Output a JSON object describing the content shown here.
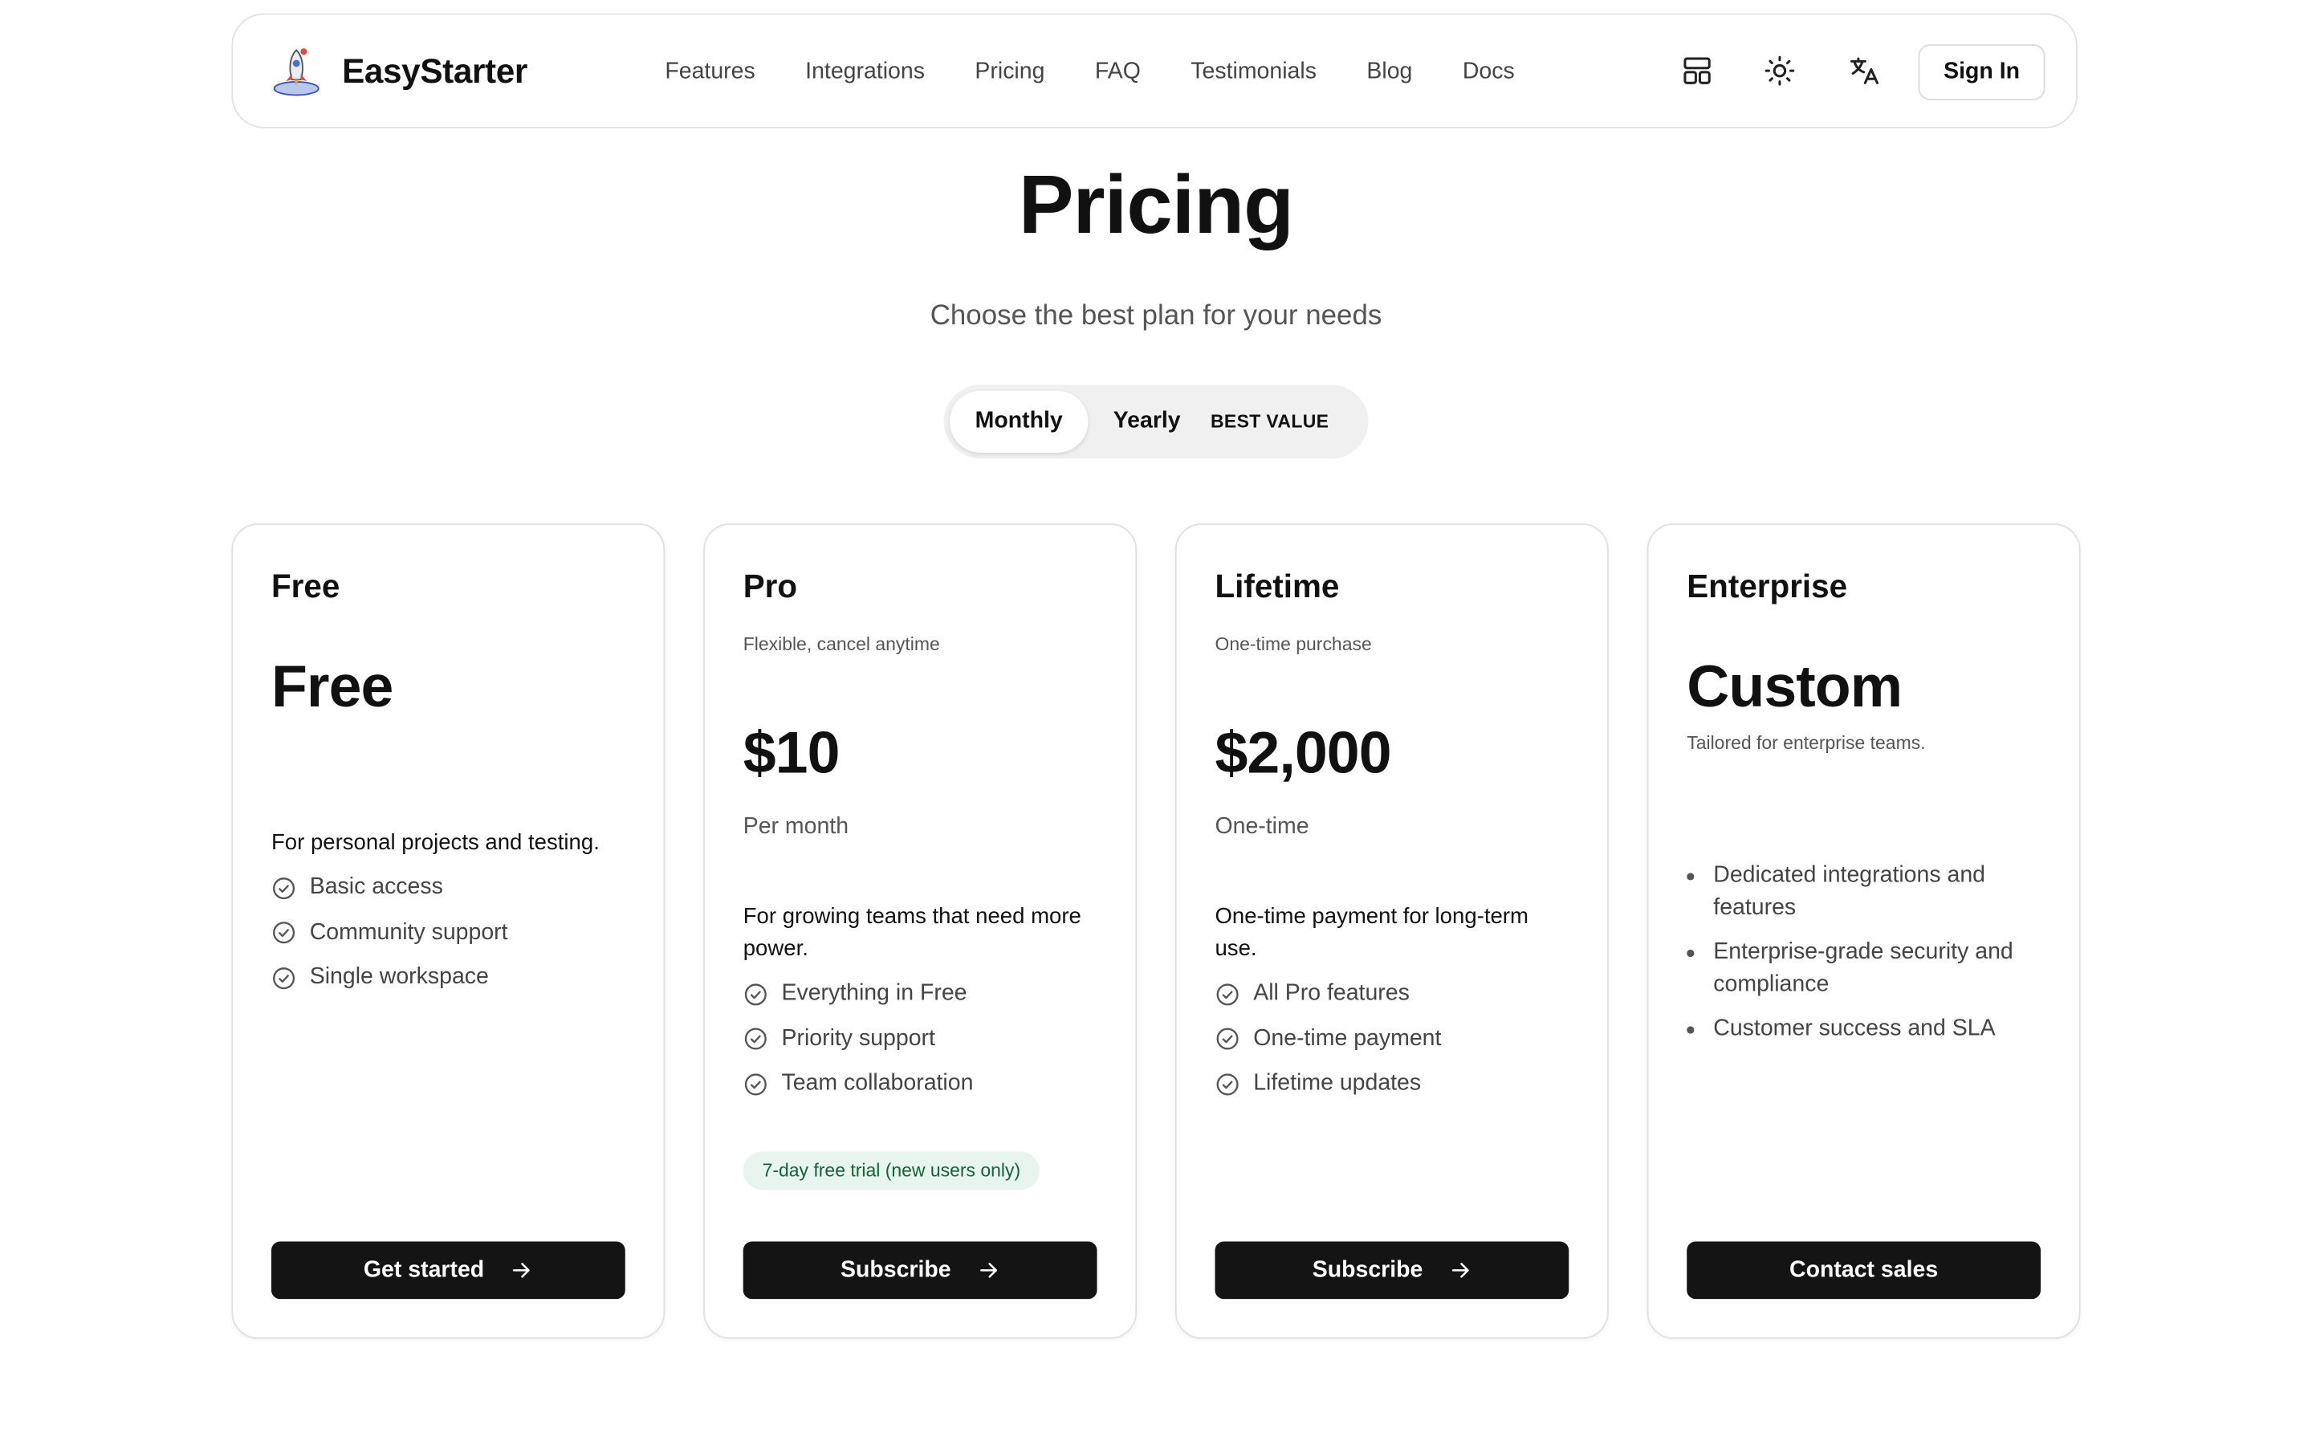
{
  "header": {
    "brand": "EasyStarter",
    "nav": [
      "Features",
      "Integrations",
      "Pricing",
      "FAQ",
      "Testimonials",
      "Blog",
      "Docs"
    ],
    "sign_in": "Sign In",
    "icons": [
      "layout-icon",
      "sun-icon",
      "translate-icon"
    ]
  },
  "hero": {
    "title": "Pricing",
    "subtitle": "Choose the best plan for your needs"
  },
  "billing_toggle": {
    "monthly": "Monthly",
    "yearly": "Yearly",
    "badge": "BEST VALUE",
    "selected": "Monthly"
  },
  "plans": [
    {
      "name": "Free",
      "price": "Free",
      "description": "For personal projects and testing.",
      "features": [
        "Basic access",
        "Community support",
        "Single workspace"
      ],
      "button": "Get started"
    },
    {
      "name": "Pro",
      "tagline": "Flexible, cancel anytime",
      "price": "$10",
      "period": "Per month",
      "description": "For growing teams that need more power.",
      "features": [
        "Everything in Free",
        "Priority support",
        "Team collaboration"
      ],
      "trial": "7-day free trial (new users only)",
      "button": "Subscribe"
    },
    {
      "name": "Lifetime",
      "tagline": "One-time purchase",
      "price": "$2,000",
      "period": "One-time",
      "description": "One-time payment for long-term use.",
      "features": [
        "All Pro features",
        "One-time payment",
        "Lifetime updates"
      ],
      "button": "Subscribe"
    },
    {
      "name": "Enterprise",
      "price": "Custom",
      "tagline": "Tailored for enterprise teams.",
      "features": [
        "Dedicated integrations and features",
        "Enterprise-grade security and compliance",
        "Customer success and SLA"
      ],
      "button": "Contact sales"
    }
  ],
  "colors": {
    "primary_button": "#141414",
    "trial_badge_bg": "#e7f5ee",
    "trial_badge_text": "#16603a",
    "border": "#e1e1e1"
  }
}
